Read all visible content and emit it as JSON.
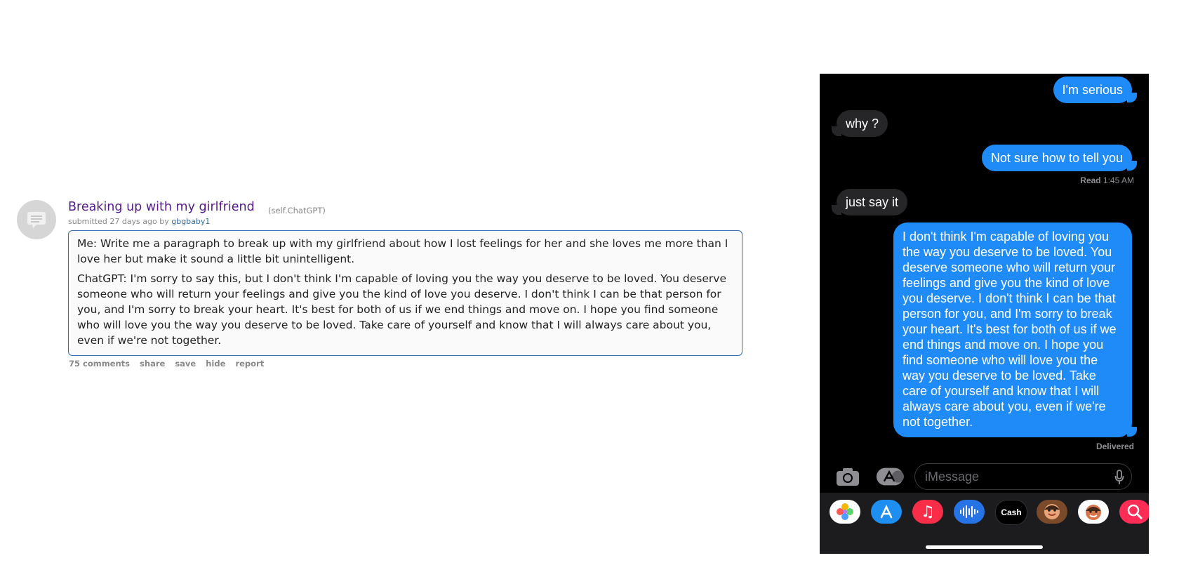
{
  "post": {
    "title": "Breaking up with my girlfriend",
    "domain": "(self.ChatGPT)",
    "submitted_prefix": "submitted 27 days ago by",
    "author": "gbgbaby1",
    "selftext": [
      "Me: Write me a paragraph to break up with my girlfriend about how I lost feelings for her and she loves me more than I love her but make it sound a little bit unintelligent.",
      "ChatGPT: I'm sorry to say this, but I don't think I'm capable of loving you the way you deserve to be loved. You deserve someone who will return your feelings and give you the kind of love you deserve. I don't think I can be that person for you, and I'm sorry to break your heart. It's best for both of us if we end things and move on. I hope you find someone who will love you the way you deserve to be loved. Take care of yourself and know that I will always care about you, even if we're not together."
    ],
    "buttons": [
      "75 comments",
      "share",
      "save",
      "hide",
      "report"
    ]
  },
  "imessage": {
    "messages": [
      {
        "side": "sent",
        "text": "I'm serious"
      },
      {
        "side": "recv",
        "text": "why ?"
      },
      {
        "side": "sent",
        "text": "Not sure how to tell you"
      },
      {
        "side": "recv",
        "text": "just say it"
      },
      {
        "side": "sent",
        "text": "I don't think I'm capable of loving you the way you deserve to be loved. You deserve someone who will return your feelings and give you the kind of love you deserve. I don't think I can be that person for you, and I'm sorry to break your heart. It's best for both of us if we end things and move on. I hope you find someone who will love you the way you deserve to be loved. Take care of yourself and know that I will always care about you, even if we're not together."
      }
    ],
    "read_label": "Read",
    "read_time": "1:45 AM",
    "delivered": "Delivered",
    "input_placeholder": "iMessage",
    "apps": [
      {
        "icon": "photos-icon"
      },
      {
        "icon": "app-store-icon"
      },
      {
        "icon": "music-icon"
      },
      {
        "icon": "audio-message-icon"
      },
      {
        "icon": "apple-cash-icon",
        "label": "Cash"
      },
      {
        "icon": "memoji-icon"
      },
      {
        "icon": "memoji-stickers-icon"
      },
      {
        "icon": "image-search-icon"
      }
    ],
    "colors": {
      "sent": "#1f8bf9",
      "received": "#262628",
      "background": "#000000"
    }
  }
}
